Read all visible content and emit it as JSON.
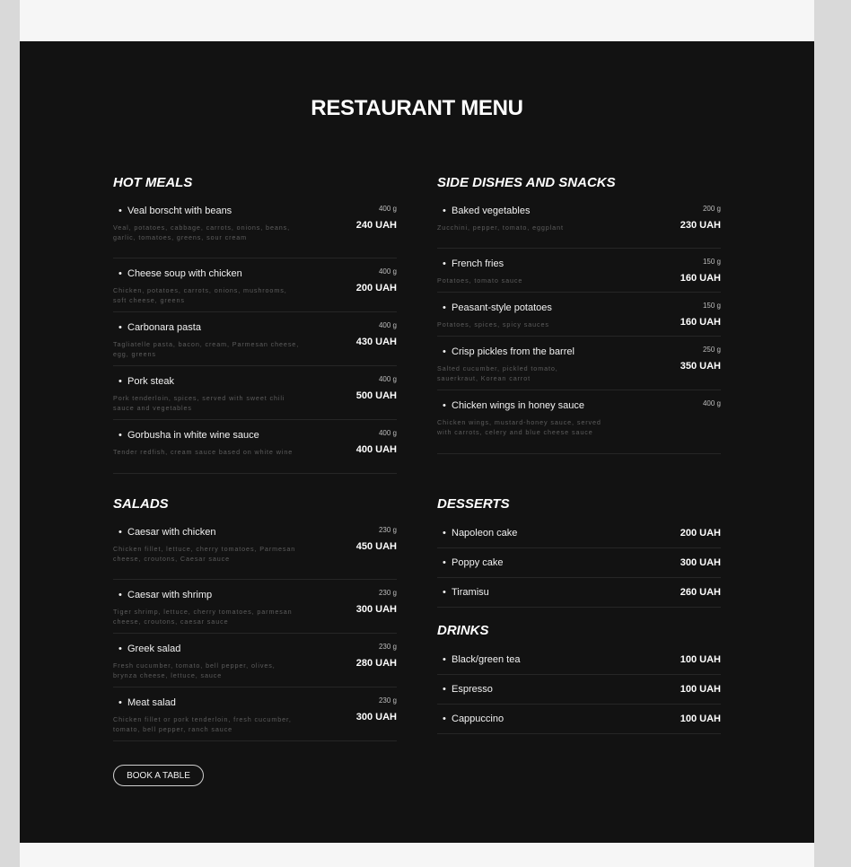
{
  "page_title": "RESTAURANT MENU",
  "book_button": "BOOK A TABLE",
  "sections": {
    "hot_meals": {
      "title": "HOT MEALS",
      "items": [
        {
          "name": "Veal borscht with beans",
          "description": "Veal, potatoes, cabbage, carrots, onions, beans, garlic, tomatoes, greens, sour cream",
          "weight": "400 g",
          "price": "240 UAH"
        },
        {
          "name": "Cheese soup with chicken",
          "description": "Chicken, potatoes, carrots, onions, mushrooms, soft cheese, greens",
          "weight": "400 g",
          "price": "200 UAH"
        },
        {
          "name": "Carbonara pasta",
          "description": "Tagliatelle pasta, bacon, cream, Parmesan cheese, egg, greens",
          "weight": "400 g",
          "price": "430 UAH"
        },
        {
          "name": "Pork steak",
          "description": "Pork tenderloin, spices, served with sweet chili sauce and vegetables",
          "weight": "400 g",
          "price": "500 UAH"
        },
        {
          "name": "Gorbusha in white wine sauce",
          "description": "Tender redfish, cream sauce based on white wine",
          "weight": "400 g",
          "price": "400 UAH"
        }
      ]
    },
    "side_dishes": {
      "title": "SIDE DISHES AND SNACKS",
      "items": [
        {
          "name": "Baked vegetables",
          "description": "Zucchini, pepper, tomato, eggplant",
          "weight": "200 g",
          "price": "230 UAH"
        },
        {
          "name": "French fries",
          "description": "Potatoes, tomato sauce",
          "weight": "150 g",
          "price": "160 UAH"
        },
        {
          "name": "Peasant-style potatoes",
          "description": "Potatoes, spices, spicy sauces",
          "weight": "150 g",
          "price": "160 UAH"
        },
        {
          "name": "Crisp pickles from the barrel",
          "description": "Salted cucumber, pickled tomato, sauerkraut, Korean carrot",
          "weight": "250 g",
          "price": "350 UAH"
        },
        {
          "name": "Chicken wings in honey sauce",
          "description": "Chicken wings, mustard-honey sauce, served with carrots, celery and blue cheese sauce",
          "weight": "400 g",
          "price": ""
        }
      ]
    },
    "salads": {
      "title": "SALADS",
      "items": [
        {
          "name": "Caesar with chicken",
          "description": "Chicken fillet, lettuce, cherry tomatoes, Parmesan cheese, croutons, Caesar sauce",
          "weight": "230 g",
          "price": "450 UAH"
        },
        {
          "name": "Caesar with shrimp",
          "description": "Tiger shrimp, lettuce, cherry tomatoes, parmesan cheese, croutons, caesar sauce",
          "weight": "230 g",
          "price": "300 UAH"
        },
        {
          "name": "Greek salad",
          "description": "Fresh cucumber, tomato, bell pepper, olives, brynza cheese, lettuce, sauce",
          "weight": "230 g",
          "price": "280 UAH"
        },
        {
          "name": "Meat salad",
          "description": "Chicken fillet or pork tenderloin, fresh cucumber, tomato, bell pepper, ranch sauce",
          "weight": "230 g",
          "price": "300 UAH"
        }
      ]
    },
    "desserts": {
      "title": "DESSERTS",
      "items": [
        {
          "name": "Napoleon cake",
          "price": "200 UAH"
        },
        {
          "name": "Poppy cake",
          "price": "300 UAH"
        },
        {
          "name": "Tiramisu",
          "price": "260 UAH"
        }
      ]
    },
    "drinks": {
      "title": "DRINKS",
      "items": [
        {
          "name": "Black/green tea",
          "price": "100 UAH"
        },
        {
          "name": "Espresso",
          "price": "100 UAH"
        },
        {
          "name": "Cappuccino",
          "price": "100 UAH"
        }
      ]
    }
  }
}
